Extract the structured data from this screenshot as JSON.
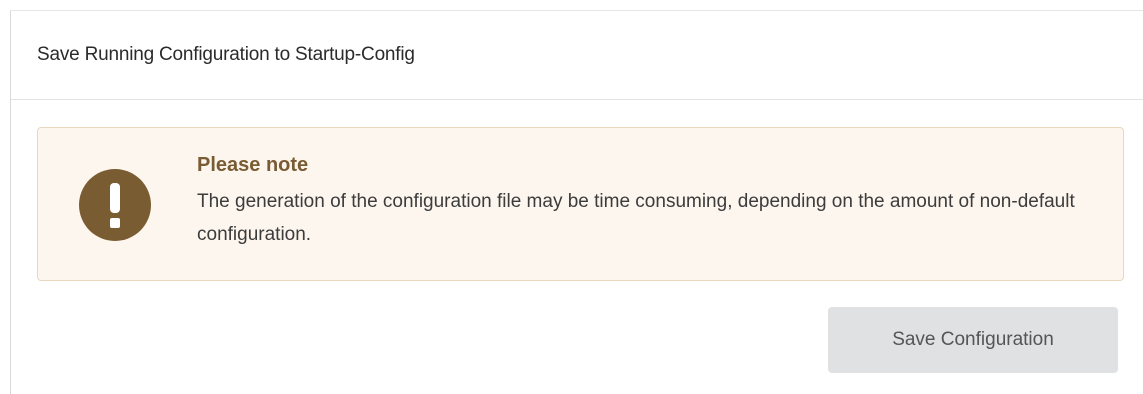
{
  "panel": {
    "title": "Save Running Configuration to Startup-Config"
  },
  "alert": {
    "icon": "exclamation-circle-icon",
    "heading": "Please note",
    "message": "The generation of the configuration file may be time consuming, depending on the amount of non-default configuration.",
    "background_color": "#fdf6ee",
    "accent_color": "#7a5c32"
  },
  "actions": {
    "save_label": "Save Configuration"
  }
}
